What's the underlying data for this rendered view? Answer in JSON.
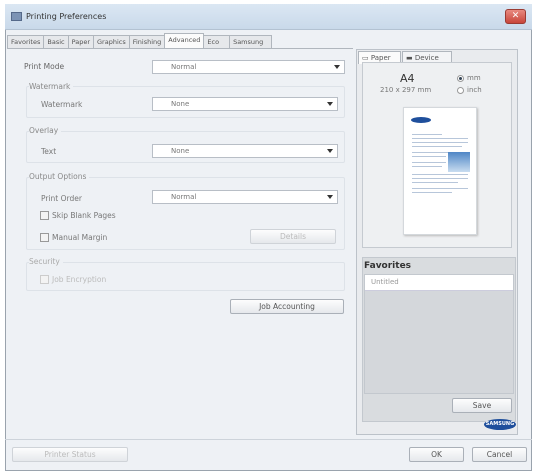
{
  "window": {
    "title": "Printing Preferences",
    "close_glyph": "✕"
  },
  "tabs": [
    "Favorites",
    "Basic",
    "Paper",
    "Graphics",
    "Finishing",
    "Advanced",
    "Eco",
    "Samsung"
  ],
  "active_tab": "Advanced",
  "print_mode": {
    "label": "Print Mode",
    "value": "Normal"
  },
  "watermark": {
    "section": "Watermark",
    "label": "Watermark",
    "value": "None"
  },
  "overlay": {
    "section": "Overlay",
    "label": "Text",
    "value": "None"
  },
  "output_options": {
    "section": "Output Options",
    "print_order_label": "Print Order",
    "print_order_value": "Normal",
    "skip_blank_pages": "Skip Blank Pages",
    "manual_margin": "Manual Margin",
    "details_button": "Details"
  },
  "security": {
    "section": "Security",
    "job_encryption": "Job Encryption"
  },
  "job_accounting_button": "Job Accounting",
  "preview": {
    "tabs": [
      "Paper",
      "Device"
    ],
    "paper_size": "A4",
    "paper_dims": "210 x 297 mm",
    "units": [
      "mm",
      "inch"
    ],
    "selected_unit": "mm"
  },
  "favorites": {
    "title": "Favorites",
    "selected_item": "Untitled",
    "save_button": "Save"
  },
  "brand": "SAMSUNG",
  "footer": {
    "printer_status_button": "Printer Status",
    "ok_button": "OK",
    "cancel_button": "Cancel"
  }
}
